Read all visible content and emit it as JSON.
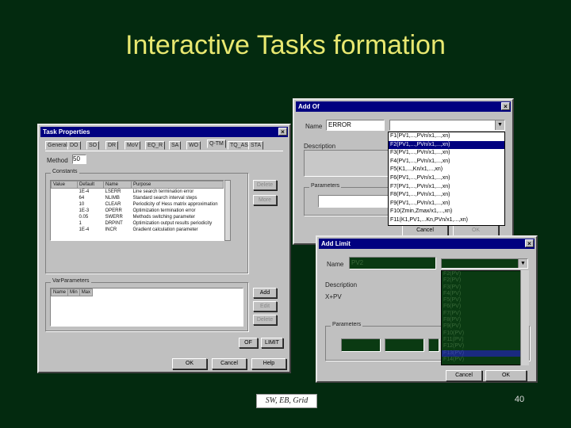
{
  "slide": {
    "title": "Interactive Tasks formation",
    "footer": "SW, EB, Grid",
    "page_number": "40"
  },
  "task_properties": {
    "title": "Task Properties",
    "close_glyph": "×",
    "tabs": [
      "General",
      "DO",
      "SO",
      "DR",
      "MoV",
      "EQ_R",
      "SA",
      "WO",
      "Q-TM",
      "TQ_AS",
      "STA"
    ],
    "active_tab": "Q-TM",
    "method_label": "Method",
    "method_value": "50",
    "constants_label": "Constants",
    "constants_columns": [
      "Value",
      "Default",
      "Name",
      "Purpose"
    ],
    "constants_rows": [
      [
        "",
        "1E-4",
        "LSERR",
        "Line search termination error"
      ],
      [
        "",
        "64",
        "NLIMB",
        "Standard search interval steps"
      ],
      [
        "",
        "10",
        "CLEAR",
        "Periodicity of Hess matrix approximation"
      ],
      [
        "",
        "1E-3",
        "OPERR",
        "Optimization termination error"
      ],
      [
        "",
        "0.05",
        "SWERR",
        "Methods switching parameter"
      ],
      [
        "",
        "1",
        "DRPINT",
        "Optimization output results periodicity"
      ],
      [
        "",
        "1E-4",
        "INCR",
        "Gradient calculation parameter"
      ]
    ],
    "delete_label": "Delete",
    "more_label": "More",
    "varparams_label": "VarParameters",
    "varparams_columns": [
      "Name",
      "Min",
      "Max"
    ],
    "add_label": "Add",
    "edit_label": "Edit",
    "delete2_label": "Delete",
    "of_label": "OF",
    "limit_label": "LIMIT",
    "ok_label": "OK",
    "cancel_label": "Cancel",
    "help_label": "Help"
  },
  "add_of": {
    "title": "Add Of",
    "close_glyph": "×",
    "name_label": "Name",
    "name_value": "ERROR",
    "description_label": "Description",
    "parameters_label": "Parameters",
    "cancel_label": "Cancel",
    "ok_label": "OK",
    "options": [
      "F1(PV1,...,PVn/x1,...,xn)",
      "F2(PV1,...,PVn/x1,...,xn)",
      "F3(PV1,...,PVn/x1,...,xn)",
      "F4(PV1,...,PVn/x1,...,xn)",
      "F5(K1,...,Kn/x1,...,xn)",
      "F6(PV1,...,PVn/x1,...,xn)",
      "F7(PV1,...,PVn/x1,...,xn)",
      "F8(PV1,...,PVn/x1,...,xn)",
      "F9(PV1,...,PVn/x1,...,xn)",
      "F10(Zmin,Zmax/x1,...,xn)",
      "F11(K1,PV1,...Kn,PVn/x1,...,xn)"
    ],
    "selected_index": 1
  },
  "add_limit": {
    "title": "Add Limit",
    "close_glyph": "×",
    "name_label": "Name",
    "name_value": "PV2",
    "description_label": "Description",
    "description_value": "X+PV",
    "parameters_label": "Parameters",
    "cancel_label": "Cancel",
    "ok_label": "OK",
    "options": [
      "F2(PV)",
      "F2(PV)",
      "F3(PV)",
      "F4(PV)",
      "F5(PV)",
      "F6(PV)",
      "F7(PV)",
      "F8(PV)",
      "F9(PV)",
      "F10(PV)",
      "F11(PV)",
      "F12(PV)",
      "F13(PV)",
      "F14(PV)"
    ],
    "selected_index": 12
  },
  "colors": {
    "background": "#032a0f",
    "title": "#e8e870",
    "titlebar": "#000080",
    "window": "#c0c0c0"
  }
}
